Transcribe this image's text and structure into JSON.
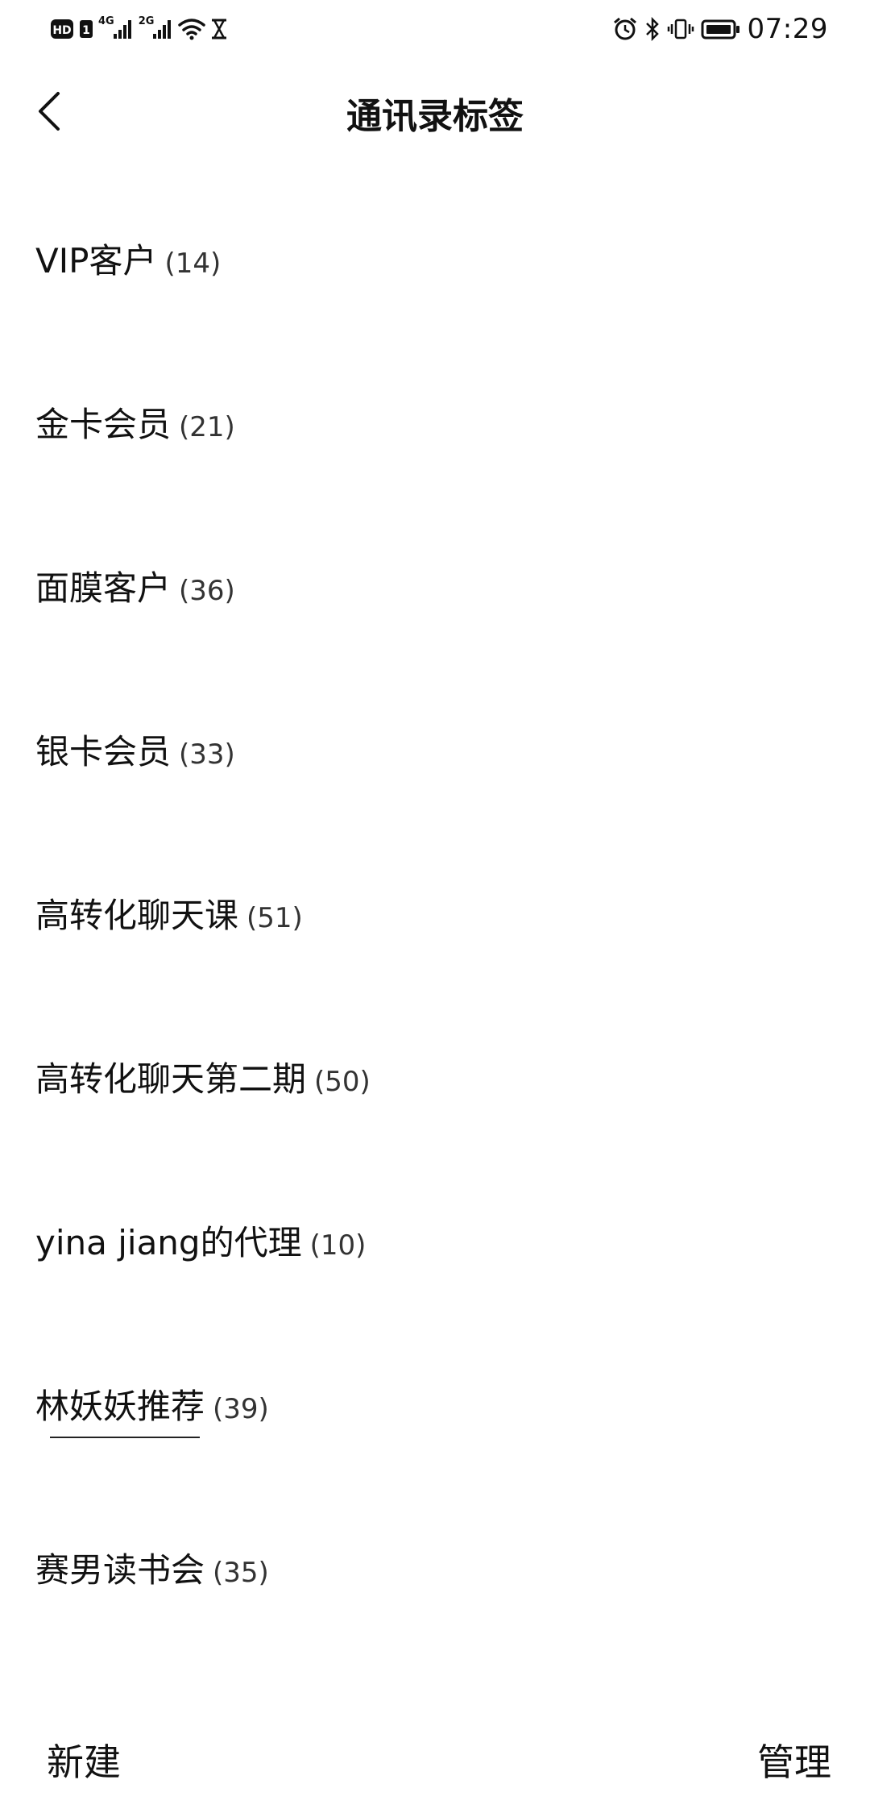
{
  "status_bar": {
    "time": "07:29",
    "network_1": "4G",
    "network_2": "2G",
    "left_icons": [
      "hd-icon",
      "sim-icon",
      "signal-4g-icon",
      "signal-2g-icon",
      "wifi-icon",
      "hourglass-icon"
    ],
    "right_icons": [
      "alarm-icon",
      "bluetooth-icon",
      "vibrate-icon",
      "battery-icon"
    ]
  },
  "header": {
    "title": "通讯录标签"
  },
  "tags": [
    {
      "name": "VIP客户",
      "count": "(14)"
    },
    {
      "name": "金卡会员",
      "count": "(21)"
    },
    {
      "name": "面膜客户",
      "count": "(36)"
    },
    {
      "name": "银卡会员",
      "count": "(33)"
    },
    {
      "name": "高转化聊天课",
      "count": "(51)"
    },
    {
      "name": "高转化聊天第二期",
      "count": "(50)"
    },
    {
      "name": "yina jiang的代理",
      "count": "(10)"
    },
    {
      "name": "林妖妖推荐",
      "count": "(39)"
    },
    {
      "name": "赛男读书会",
      "count": "(35)"
    }
  ],
  "bottom": {
    "new_label": "新建",
    "manage_label": "管理"
  }
}
